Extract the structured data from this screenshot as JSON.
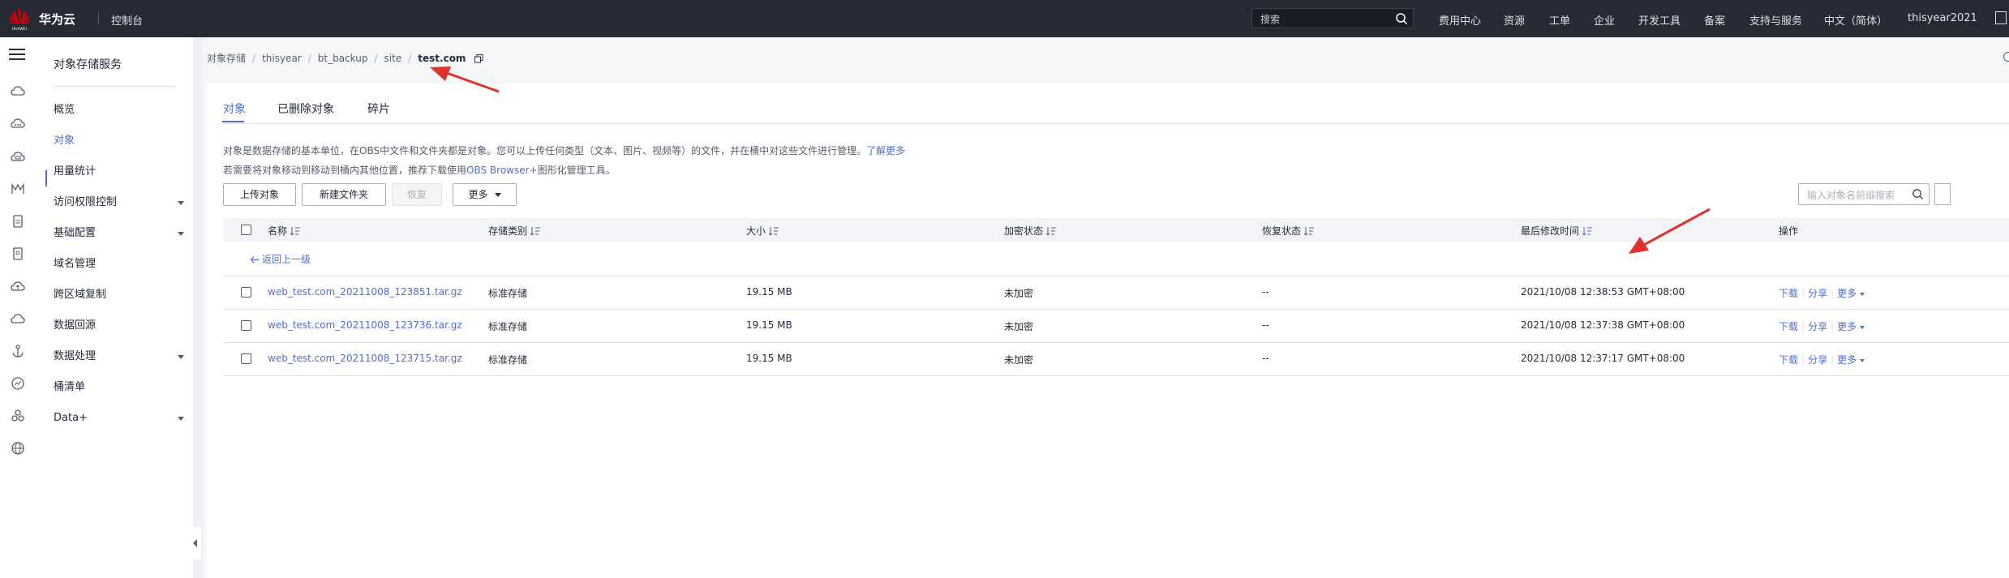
{
  "topbar": {
    "brand": "华为云",
    "logo_text": "HUAWEI",
    "console": "控制台",
    "search_placeholder": "搜索",
    "nav": [
      "费用中心",
      "资源",
      "工单",
      "企业",
      "开发工具",
      "备案",
      "支持与服务",
      "中文（简体）",
      "thisyear2021"
    ]
  },
  "rail_icons": [
    "menu-icon",
    "cloud-icon",
    "chat-icon",
    "storage-icon",
    "monitor-icon",
    "document-icon",
    "key-icon",
    "cloud-upload-icon",
    "cloud-sync-icon",
    "anchor-icon",
    "chart-icon",
    "group-icon",
    "globe-icon"
  ],
  "sidebar": {
    "title": "对象存储服务",
    "items": [
      {
        "label": "概览",
        "active": false,
        "expandable": false
      },
      {
        "label": "对象",
        "active": true,
        "expandable": false
      },
      {
        "label": "用量统计",
        "active": false,
        "expandable": false
      },
      {
        "label": "访问权限控制",
        "active": false,
        "expandable": true
      },
      {
        "label": "基础配置",
        "active": false,
        "expandable": true
      },
      {
        "label": "域名管理",
        "active": false,
        "expandable": false
      },
      {
        "label": "跨区域复制",
        "active": false,
        "expandable": false
      },
      {
        "label": "数据回源",
        "active": false,
        "expandable": false
      },
      {
        "label": "数据处理",
        "active": false,
        "expandable": true
      },
      {
        "label": "桶清单",
        "active": false,
        "expandable": false
      },
      {
        "label": "Data+",
        "active": false,
        "expandable": true
      }
    ]
  },
  "breadcrumb": {
    "items": [
      "对象存储",
      "thisyear",
      "bt_backup",
      "site"
    ],
    "current": "test.com",
    "separator": "/"
  },
  "tabs": [
    "对象",
    "已删除对象",
    "碎片"
  ],
  "description": {
    "line1": "对象是数据存储的基本单位，在OBS中文件和文件夹都是对象。您可以上传任何类型（文本、图片、视频等）的文件，并在桶中对这些文件进行管理。",
    "learn_more": "了解更多",
    "line2_prefix": "若需要将对象移动到移动到桶内其他位置，推荐下载使用",
    "line2_link": "OBS Browser+",
    "line2_suffix": "图形化管理工具。"
  },
  "toolbar": {
    "upload": "上传对象",
    "new_folder": "新建文件夹",
    "restore": "恢复",
    "more": "更多",
    "search_placeholder": "输入对象名前缀搜索"
  },
  "table": {
    "columns": [
      "名称",
      "存储类别",
      "大小",
      "加密状态",
      "恢复状态",
      "最后修改时间",
      "操作"
    ],
    "back_label": "返回上一级",
    "rows": [
      {
        "name": "web_test.com_20211008_123851.tar.gz",
        "storage_class": "标准存储",
        "size": "19.15 MB",
        "encryption": "未加密",
        "restore": "--",
        "modified": "2021/10/08 12:38:53 GMT+08:00"
      },
      {
        "name": "web_test.com_20211008_123736.tar.gz",
        "storage_class": "标准存储",
        "size": "19.15 MB",
        "encryption": "未加密",
        "restore": "--",
        "modified": "2021/10/08 12:37:38 GMT+08:00"
      },
      {
        "name": "web_test.com_20211008_123715.tar.gz",
        "storage_class": "标准存储",
        "size": "19.15 MB",
        "encryption": "未加密",
        "restore": "--",
        "modified": "2021/10/08 12:37:17 GMT+08:00"
      }
    ],
    "actions": {
      "download": "下载",
      "share": "分享",
      "more": "更多"
    }
  },
  "colors": {
    "topbar_bg": "#252a35",
    "link": "#526ecc",
    "annotation_arrow": "#e0322b",
    "logo": "#c7000b"
  }
}
